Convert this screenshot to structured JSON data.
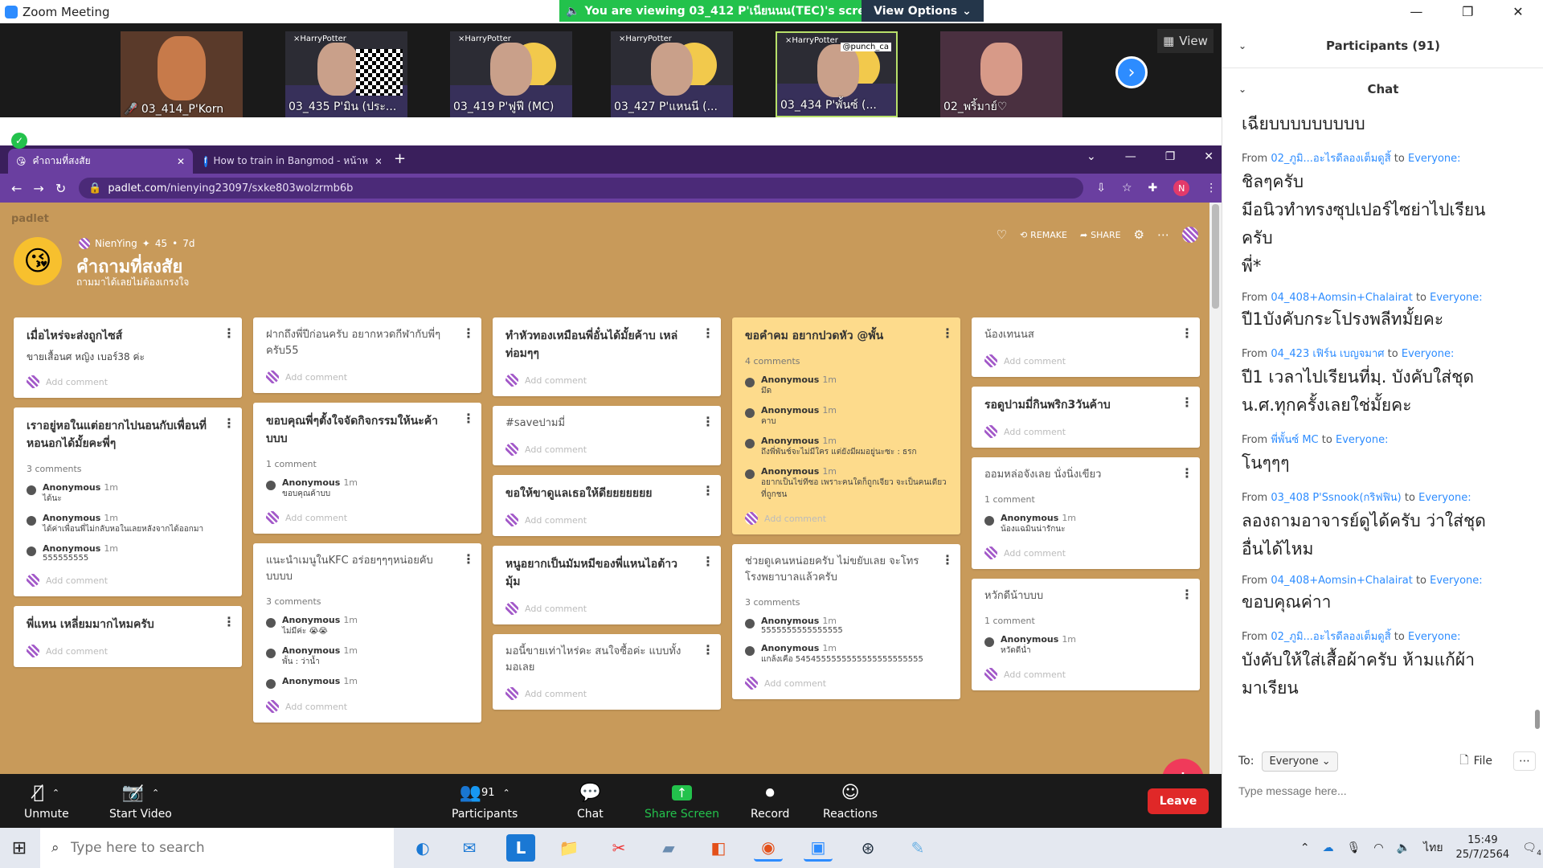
{
  "window": {
    "title": "Zoom Meeting",
    "viewing_banner": "You are viewing 03_412 P'เนียนนน(TEC)'s screen",
    "view_options": "View Options"
  },
  "video_tiles": [
    {
      "name": "03_414_P'Korn",
      "muted": true
    },
    {
      "name": "03_435 P'มิน (ประ..."
    },
    {
      "name": "03_419 P'ฟูฟี (MC)"
    },
    {
      "name": "03_427 P'แหนนี (..."
    },
    {
      "name": "03_434 P'พั้นซ์ (...",
      "label": "@punch_ca"
    },
    {
      "name": "02_พริ้มาย์♡"
    }
  ],
  "video_strip": {
    "view_label": "View",
    "harrypotter": "×HarryPotter"
  },
  "browser": {
    "tabs": [
      {
        "label": "คำถามที่สงสัย",
        "active": true
      },
      {
        "label": "How to train in Bangmod - หน้าห"
      }
    ],
    "url_host": "padlet.com",
    "url_path": "/nienying23097/sxke803wolzrmb6b",
    "avatar_letter": "N"
  },
  "padlet": {
    "logo": "padlet",
    "author": "NienYing",
    "karma": "45",
    "age": "7d",
    "title": "คำถามที่สงสัย",
    "subtitle": "ถามมาได้เลยไม่ต้องเกรงใจ",
    "actions": {
      "remake": "REMAKE",
      "share": "SHARE"
    },
    "add_comment": "Add comment",
    "columns": [
      [
        {
          "title": "เมื่อไหร่จะส่งถูกไซส์",
          "body": "ขายเสื้อนศ หญิง เบอร์38 ค่ะ"
        },
        {
          "title": "เราอยู่หอในแต่อยากไปนอนกับเพื่อนที่หอนอกได้มั้ยคะพี่ๆ",
          "count": "3 comments",
          "comments": [
            {
              "n": "Anonymous",
              "t": "1m",
              "x": "ได้นะ"
            },
            {
              "n": "Anonymous",
              "t": "1m",
              "x": "ได้ค่าเพื่อนพี่ไม่กลับหอในเลยหลังจากได้ออกมา"
            },
            {
              "n": "Anonymous",
              "t": "1m",
              "x": "555555555"
            }
          ]
        },
        {
          "title": "พี่แหน เหลี่ยมมากไหมครับ"
        }
      ],
      [
        {
          "plain": "ฝากถึงพี่ปีก่อนครับ อยากหวดกีฬากับพี่ๆครับ55"
        },
        {
          "title": "ขอบคุณพี่ๆตั้งใจจัดกิจกรรมให้นะค้าบบบ",
          "count": "1 comment",
          "comments": [
            {
              "n": "Anonymous",
              "t": "1m",
              "x": "ขอบคุณค้าบบ"
            }
          ]
        },
        {
          "plain": "แนะนำเมนูในKFC อร่อยๆๆๆหน่อยคับบบบบ",
          "count": "3 comments",
          "comments": [
            {
              "n": "Anonymous",
              "t": "1m",
              "x": "ไม่มีค่ะ 😭😭"
            },
            {
              "n": "Anonymous",
              "t": "1m",
              "x": "พั้น : ว่าน้ำ"
            },
            {
              "n": "Anonymous",
              "t": "1m",
              "x": ""
            }
          ]
        }
      ],
      [
        {
          "title": "ทำหัวทองเหมือนพี่อั๋นได้มั้ยค้าบ เหล่ท่อมๆๆ"
        },
        {
          "plain": "#saveปามมี่"
        },
        {
          "title": "ขอให้ขาดูแลเธอให้ดียยยยยยย"
        },
        {
          "title": "หนูอยากเป็นมัมหมีของพี่แหนไอต้าวมุ้ม"
        },
        {
          "plain": "มอนี้ขายเท่าไหร่คะ สนใจซื้อค่ะ แบบทั้งมอเลย"
        }
      ],
      [
        {
          "title": "ขอคำคม อยากปวดหัว @พั้น",
          "yellow": true,
          "count": "4 comments",
          "comments": [
            {
              "n": "Anonymous",
              "t": "1m",
              "x": "มึด"
            },
            {
              "n": "Anonymous",
              "t": "1m",
              "x": "คาบ"
            },
            {
              "n": "Anonymous",
              "t": "1m",
              "x": "ถึงพี่พันช์จะไม่มีใคร แต่ยังมีผมอยู่นะซะ : ธรก"
            },
            {
              "n": "Anonymous",
              "t": "1m",
              "x": "อยากเป็นไข่ทีซอ เพราะคนใดก็ถูกเจียว จะเป็นคนเดียวที่ถูกชน"
            }
          ]
        },
        {
          "plain": "ช่วยดูเคนหน่อยครับ ไม่ขยับเลย จะโทรโรงพยาบาลแล้วครับ",
          "count": "3 comments",
          "comments": [
            {
              "n": "Anonymous",
              "t": "1m",
              "x": "5555555555555555"
            },
            {
              "n": "Anonymous",
              "t": "1m",
              "x": "แกล้งเคือ 5454555555555555555555555"
            }
          ]
        }
      ],
      [
        {
          "plain": "น้องเทนนส"
        },
        {
          "title": "รอดูปามมี่กินพริก3วันค้าบ"
        },
        {
          "plain": "ออมหล่อจังเลย นั่งนิ่งเขียว",
          "count": "1 comment",
          "comments": [
            {
              "n": "Anonymous",
              "t": "1m",
              "x": "น้องแฉมินน่ารักนะ"
            }
          ]
        },
        {
          "plain": "หวักดีน้าบบบ",
          "count": "1 comment",
          "comments": [
            {
              "n": "Anonymous",
              "t": "1m",
              "x": "หวัดดีน่ำ"
            }
          ]
        }
      ]
    ]
  },
  "zoom_bar": {
    "unmute": "Unmute",
    "start_video": "Start Video",
    "participants": "Participants",
    "participants_count": "91",
    "chat": "Chat",
    "share_screen": "Share Screen",
    "record": "Record",
    "reactions": "Reactions",
    "leave": "Leave"
  },
  "chat_panel": {
    "participants_header": "Participants (91)",
    "chat_header": "Chat",
    "from_word": "From",
    "to_word": "to",
    "messages": [
      {
        "from": "",
        "to": "",
        "text": [
          "เฉียบบบบบบบบบ"
        ]
      },
      {
        "from": "02_ภูมิ...อะไรดีลองเต็มดูสิ้",
        "to": "Everyone:",
        "text": [
          "ชิลๆครับ",
          "มีอนิวทำทรงซุปเปอร์ไซย่าไปเรียน",
          "ครับ",
          "พี่*"
        ]
      },
      {
        "from": "04_408+Aomsin+Chalairat",
        "to": "Everyone:",
        "text": [
          "ปี1บังคับกระโปรงพลีทมั้ยคะ"
        ]
      },
      {
        "from": "04_423 เฟิร์น เบญจมาศ",
        "to": "Everyone:",
        "text": [
          "ปี1 เวลาไปเรียนที่มฺ. บังคับใส่ชุด",
          "น.ศ.ทุกครั้งเลยใช่มั้ยคะ"
        ]
      },
      {
        "from": "พี่พั้นซ์ MC",
        "to": "Everyone:",
        "text": [
          "โนๆๆๆ"
        ]
      },
      {
        "from": "03_408 P'Ssnook(กริฟฟิน)",
        "to": "Everyone:",
        "text": [
          "ลองถามอาจารย์ดูได้ครับ ว่าใส่ชุด",
          "อื่นได้ไหม"
        ]
      },
      {
        "from": "04_408+Aomsin+Chalairat",
        "to": "Everyone:",
        "text": [
          "ขอบคุณค่าา"
        ]
      },
      {
        "from": "02_ภูมิ...อะไรดีลองเต็มดูสิ้",
        "to": "Everyone:",
        "text": [
          "บังคับให้ใส่เสื้อผ้าครับ ห้ามแก้ผ้า",
          "มาเรียน"
        ]
      }
    ],
    "to_label": "To:",
    "to_value": "Everyone",
    "file_label": "File",
    "input_placeholder": "Type message here..."
  },
  "taskbar": {
    "search_placeholder": "Type here to search",
    "language": "ไทย",
    "time": "15:49",
    "date": "25/7/2564",
    "notif_count": "4"
  }
}
